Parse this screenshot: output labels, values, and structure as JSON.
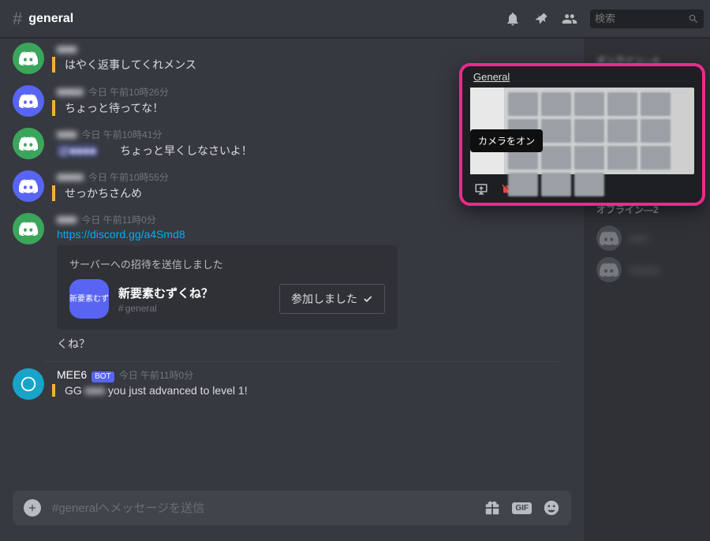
{
  "header": {
    "channel_hash": "#",
    "channel_name": "general"
  },
  "search": {
    "placeholder": "検索"
  },
  "messages": [
    {
      "id": 0,
      "avatar": "green",
      "name_blur": "■■■",
      "ts": "",
      "body": "はやく返事してくれメンス",
      "blockquote": true
    },
    {
      "id": 1,
      "avatar": "blurb",
      "name_blur": "■■■■",
      "ts": "今日 午前10時26分",
      "body": "ちょっと待ってな！",
      "blockquote": true
    },
    {
      "id": 2,
      "avatar": "green",
      "name_blur": "■■■",
      "ts": "今日 午前10時41分",
      "body_prefix_mention": "@■■■■",
      "body": "　　ちょっと早くしなさいよ！",
      "blockquote": false
    },
    {
      "id": 3,
      "avatar": "blurb",
      "name_blur": "■■■■",
      "ts": "今日 午前10時55分",
      "body": "せっかちさんめ",
      "blockquote": true
    },
    {
      "id": 4,
      "avatar": "green",
      "name_blur": "■■■",
      "ts": "今日 午前11時0分",
      "body_link": "https://discord.gg/a4Smd8",
      "embed": {
        "title": "サーバーへの招待を送信しました",
        "server_icon_text": "新要素むず",
        "server_name": "新要素むずくね？",
        "server_channel": "general",
        "joined_label": "参加しました"
      },
      "continuation": "くね？"
    },
    {
      "id": 5,
      "avatar": "aqua",
      "name": "MEE6",
      "bot": "BOT",
      "ts": "今日 午前11時0分",
      "body_before": "GG ",
      "body_blur": "■■■",
      "body_after": " you just advanced to level 1!",
      "blockquote": true
    }
  ],
  "input": {
    "placeholder": "#generalへメッセージを送信",
    "gif": "GIF"
  },
  "members": {
    "online_header": "オンライン—4",
    "offline_header": "オフライン—2",
    "offline": [
      {
        "name": "■■■"
      },
      {
        "name": "■■■■■"
      }
    ]
  },
  "popup": {
    "title": "General",
    "tooltip": "カメラをオン"
  }
}
